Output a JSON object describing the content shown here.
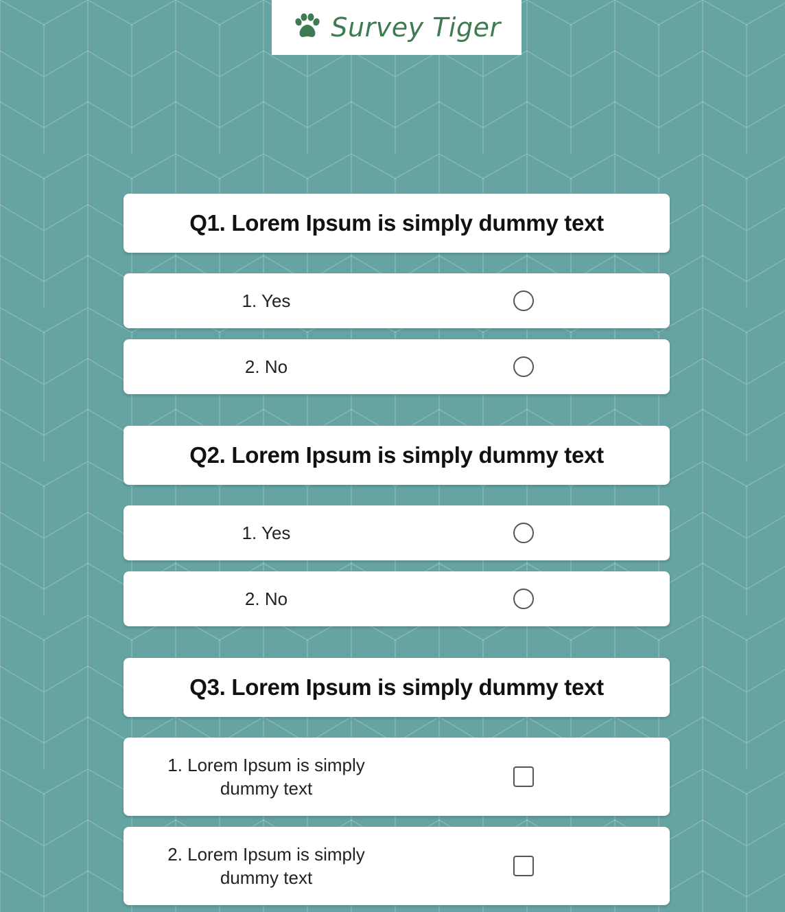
{
  "brand": {
    "name": "Survey Tiger",
    "logo_icon": "paw-icon",
    "color": "#3e7a52"
  },
  "theme": {
    "background": "#66a3a3",
    "card": "#ffffff",
    "pattern": "cube-lines"
  },
  "questions": [
    {
      "title": "Q1. Lorem Ipsum is simply dummy text",
      "input_type": "radio",
      "options": [
        {
          "label": "1. Yes",
          "selected": false
        },
        {
          "label": "2. No",
          "selected": false
        }
      ]
    },
    {
      "title": "Q2. Lorem Ipsum is simply dummy text",
      "input_type": "radio",
      "options": [
        {
          "label": "1. Yes",
          "selected": false
        },
        {
          "label": "2. No",
          "selected": false
        }
      ]
    },
    {
      "title": "Q3. Lorem Ipsum is simply dummy text",
      "input_type": "checkbox",
      "options": [
        {
          "label": "1. Lorem Ipsum is simply dummy text",
          "selected": false
        },
        {
          "label": "2. Lorem Ipsum is simply dummy text",
          "selected": false
        }
      ]
    }
  ]
}
